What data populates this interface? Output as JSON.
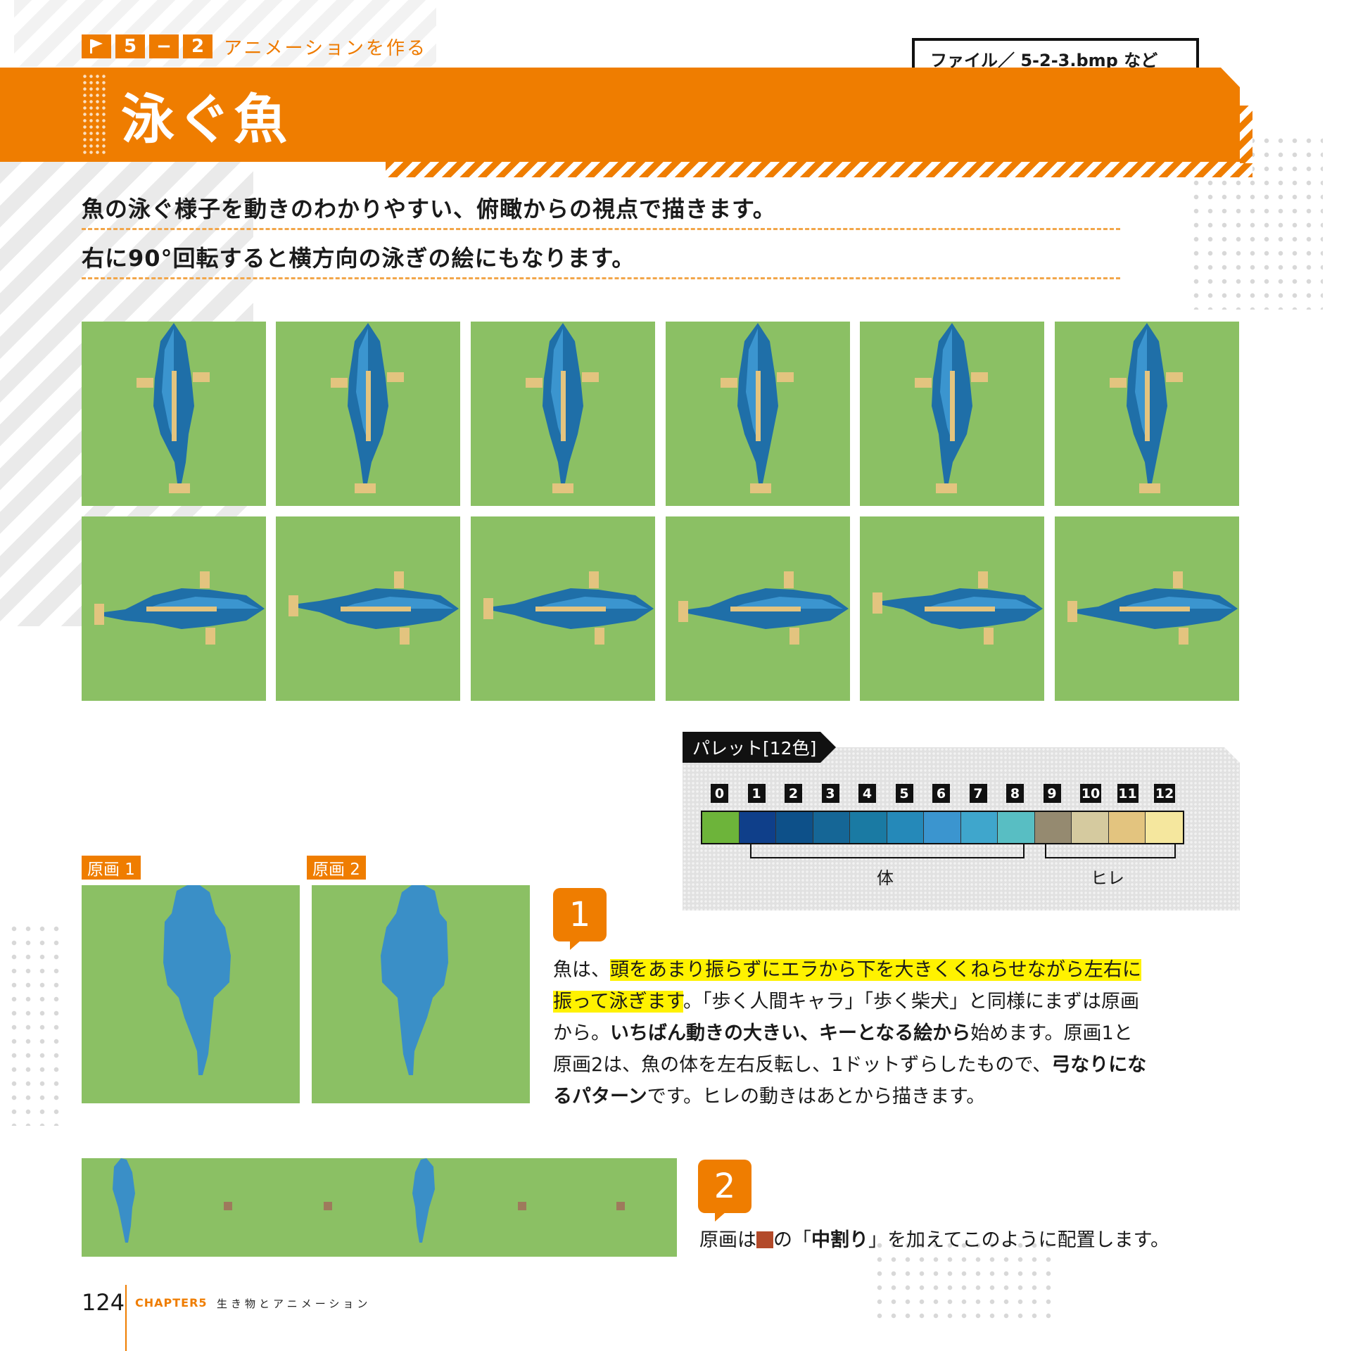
{
  "header": {
    "section_parts": [
      "5",
      "−",
      "2"
    ],
    "section_title": "アニメーションを作る",
    "file_label": "ファイル／ 5-2-3.bmp など",
    "page_title": "泳ぐ魚"
  },
  "lead": {
    "line1": "魚の泳ぐ様子を動きのわかりやすい、俯瞰からの視点で描きます。",
    "line2": "右に90°回転すると横方向の泳ぎの絵にもなります。"
  },
  "palette": {
    "label": "パレット[12色]",
    "numbers": [
      "0",
      "1",
      "2",
      "3",
      "4",
      "5",
      "6",
      "7",
      "8",
      "9",
      "10",
      "11",
      "12"
    ],
    "colors": [
      "#6db43a",
      "#0f3f8a",
      "#0d5089",
      "#156696",
      "#1a7aa3",
      "#2589b9",
      "#3b95cf",
      "#3fa6cc",
      "#58bec3",
      "#958a70",
      "#d5ca9f",
      "#e3c47f",
      "#f5e79e"
    ],
    "body_label": "体",
    "fin_label": "ヒレ"
  },
  "originals": {
    "label1": "原画 1",
    "label2": "原画 2"
  },
  "step1": {
    "number": "1",
    "hl": "頭をあまり振らずにエラから下を大きくくねらせながら左右に振って泳ぎます",
    "pre": "魚は、",
    "t1": "。「歩く人間キャラ」「歩く柴犬」と同様にまずは原画から。",
    "b1": "いちばん動きの大きい、キーとなる絵から",
    "t2": "始めます。原画1と原画2は、魚の体を左右反転し、1ドットずらしたもので、",
    "b2": "弓なりになるパターン",
    "t3": "です。ヒレの動きはあとから描きます。"
  },
  "step2": {
    "number": "2",
    "pre": "原画は",
    "mid": "の「",
    "bold": "中割り",
    "post": "」を加えてこのように配置します。"
  },
  "footer": {
    "page_number": "124",
    "chapter": "CHAPTER5",
    "chapter_title": "生き物とアニメーション"
  }
}
